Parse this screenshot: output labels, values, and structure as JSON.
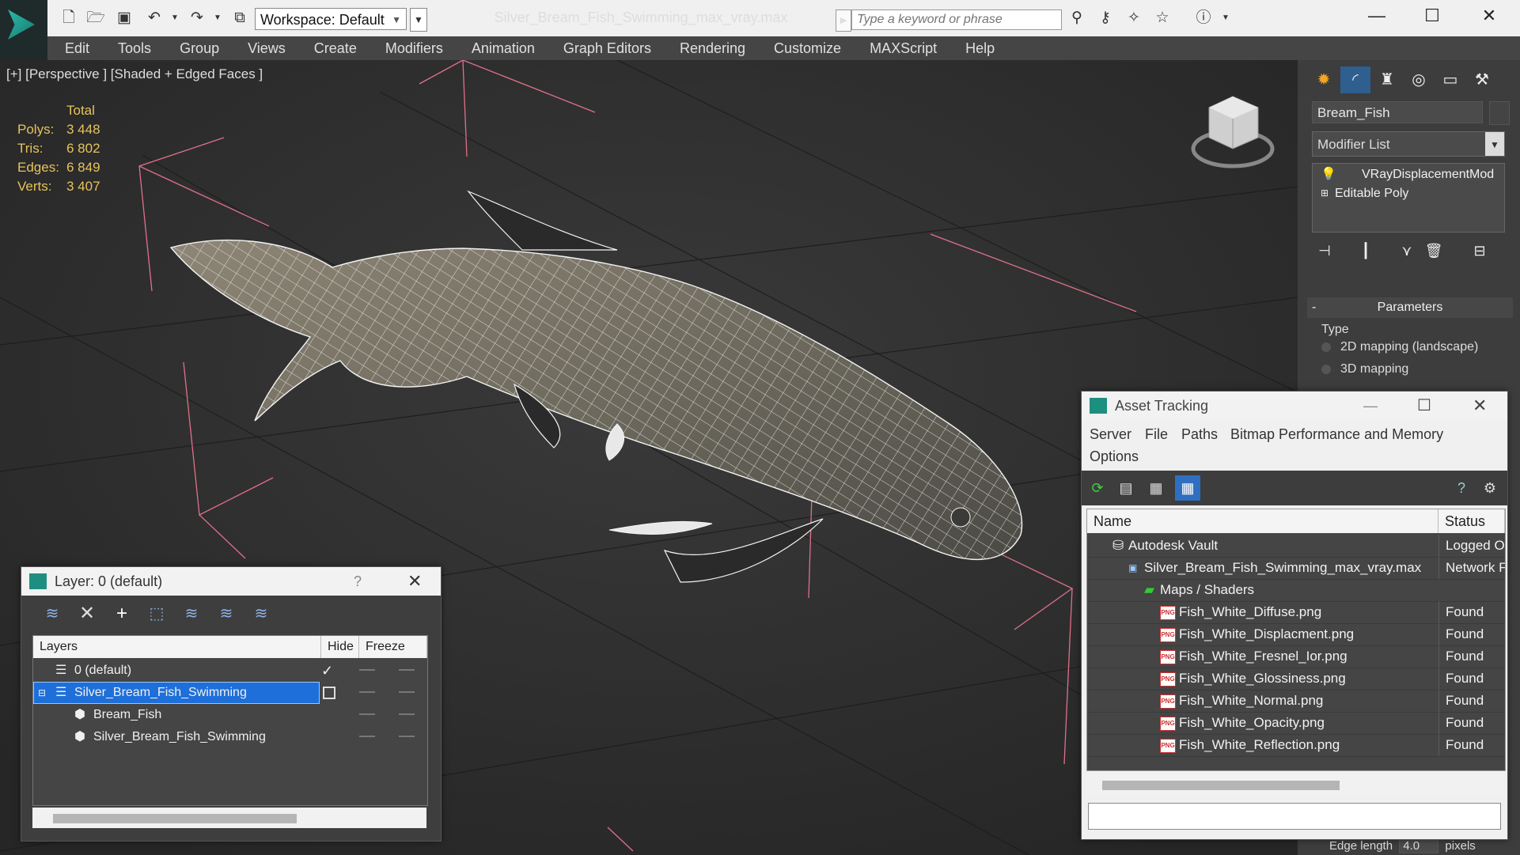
{
  "window": {
    "title": "Silver_Bream_Fish_Swimming_max_vray.max",
    "workspace_label": "Workspace: Default",
    "search_placeholder": "Type a keyword or phrase"
  },
  "menu": [
    "Edit",
    "Tools",
    "Group",
    "Views",
    "Create",
    "Modifiers",
    "Animation",
    "Graph Editors",
    "Rendering",
    "Customize",
    "MAXScript",
    "Help"
  ],
  "viewport": {
    "label": "[+] [Perspective ] [Shaded + Edged Faces ]",
    "stats": {
      "header": "Total",
      "rows": [
        {
          "label": "Polys:",
          "value": "3 448"
        },
        {
          "label": "Tris:",
          "value": "6 802"
        },
        {
          "label": "Edges:",
          "value": "6 849"
        },
        {
          "label": "Verts:",
          "value": "3 407"
        }
      ]
    }
  },
  "command_panel": {
    "object_name": "Bream_Fish",
    "modifier_list": "Modifier List",
    "stack": [
      {
        "label": "VRayDisplacementMod"
      },
      {
        "label": "Editable Poly"
      }
    ],
    "parameters_title": "Parameters",
    "type_label": "Type",
    "options": [
      "2D mapping (landscape)",
      "3D mapping"
    ],
    "edge_length_label": "Edge length",
    "edge_length_value": "4.0",
    "edge_length_unit": "pixels"
  },
  "layer_window": {
    "title": "Layer: 0 (default)",
    "help": "?",
    "columns": [
      "Layers",
      "Hide",
      "Freeze"
    ],
    "rows": [
      {
        "name": "0 (default)"
      },
      {
        "name": "Silver_Bream_Fish_Swimming"
      },
      {
        "name": "Bream_Fish"
      },
      {
        "name": "Silver_Bream_Fish_Swimming"
      }
    ]
  },
  "asset_window": {
    "title": "Asset Tracking",
    "menu": [
      "Server",
      "File",
      "Paths",
      "Bitmap Performance and Memory",
      "Options"
    ],
    "columns": [
      "Name",
      "Status"
    ],
    "rows": [
      {
        "name": "Autodesk Vault",
        "status": "Logged O"
      },
      {
        "name": "Silver_Bream_Fish_Swimming_max_vray.max",
        "status": "Network F"
      },
      {
        "name": "Maps / Shaders",
        "status": ""
      },
      {
        "name": "Fish_White_Diffuse.png",
        "status": "Found"
      },
      {
        "name": "Fish_White_Displacment.png",
        "status": "Found"
      },
      {
        "name": "Fish_White_Fresnel_Ior.png",
        "status": "Found"
      },
      {
        "name": "Fish_White_Glossiness.png",
        "status": "Found"
      },
      {
        "name": "Fish_White_Normal.png",
        "status": "Found"
      },
      {
        "name": "Fish_White_Opacity.png",
        "status": "Found"
      },
      {
        "name": "Fish_White_Reflection.png",
        "status": "Found"
      }
    ],
    "png_badge": "PNG"
  },
  "colors": {
    "accent_selection": "#1e6fd9",
    "stats_text": "#e6c35c",
    "helper_lines": "#e0708a"
  }
}
